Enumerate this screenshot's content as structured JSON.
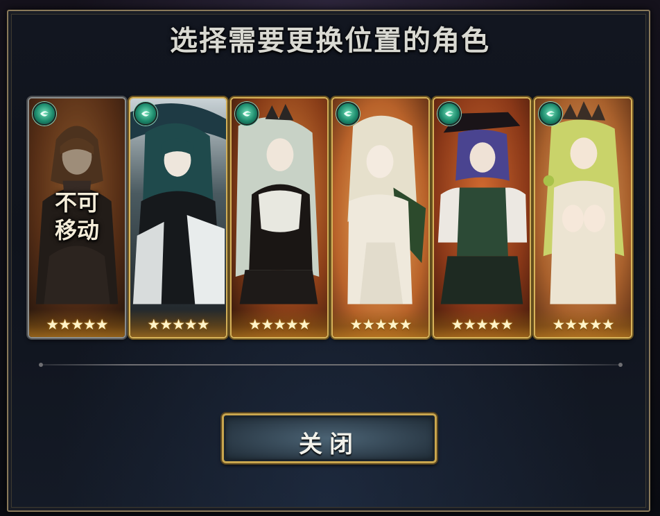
{
  "dialog": {
    "title": "选择需要更换位置的角色",
    "close_label": "关闭"
  },
  "characters": [
    {
      "element_icon": "wind-element-icon",
      "stars": "★★★★★",
      "rarity": 5,
      "locked": true,
      "locked_text_line1": "不可",
      "locked_text_line2": "移动",
      "theme_colors": [
        "#6a3a1e",
        "#3a2a26",
        "#c87a3a"
      ]
    },
    {
      "element_icon": "wind-element-icon",
      "stars": "★★★★★",
      "rarity": 5,
      "locked": false,
      "theme_colors": [
        "#1f3a3f",
        "#141a1e",
        "#e8ecec"
      ]
    },
    {
      "element_icon": "wind-element-icon",
      "stars": "★★★★★",
      "rarity": 5,
      "locked": false,
      "theme_colors": [
        "#9a4a1e",
        "#1a1614",
        "#cfd6cc"
      ]
    },
    {
      "element_icon": "wind-element-icon",
      "stars": "★★★★★",
      "rarity": 5,
      "locked": false,
      "theme_colors": [
        "#c06a2a",
        "#2c4a2c",
        "#efe9dc"
      ]
    },
    {
      "element_icon": "wind-element-icon",
      "stars": "★★★★★",
      "rarity": 5,
      "locked": false,
      "theme_colors": [
        "#a54a22",
        "#2c4a36",
        "#5a4a8a"
      ]
    },
    {
      "element_icon": "wind-element-icon",
      "stars": "★★★★★",
      "rarity": 5,
      "locked": false,
      "theme_colors": [
        "#b86a34",
        "#e9e1cf",
        "#c9d36a"
      ]
    }
  ]
}
